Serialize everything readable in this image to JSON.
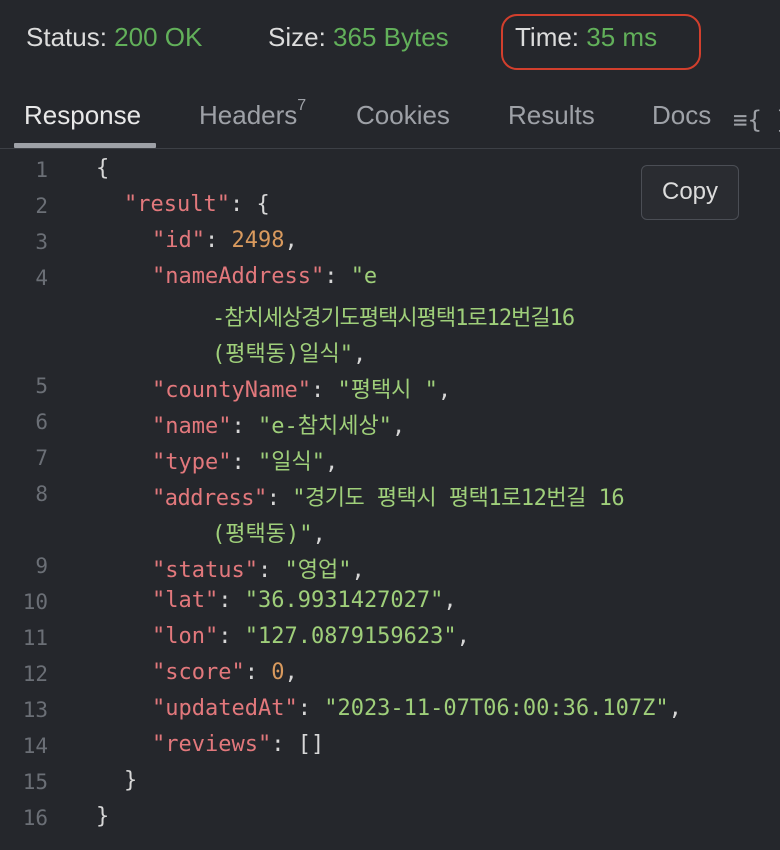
{
  "status_bar": {
    "status_label": "Status:",
    "status_value": "200 OK",
    "size_label": "Size:",
    "size_value": "365 Bytes",
    "time_label": "Time:",
    "time_value": "35 ms"
  },
  "tabs": [
    {
      "label": "Response",
      "active": true
    },
    {
      "label": "Headers",
      "badge": "7"
    },
    {
      "label": "Cookies"
    },
    {
      "label": "Results"
    },
    {
      "label": "Docs"
    }
  ],
  "menu_icon": "≡{ }",
  "copy_label": "Copy",
  "colors": {
    "status_ok": "#62b05a",
    "highlight_border": "#d23f2d",
    "json_key": "#e2787c",
    "json_string": "#9fcf7a",
    "json_number": "#d99a5e"
  },
  "code": {
    "line_numbers": [
      "1",
      "2",
      "3",
      "4",
      "5",
      "6",
      "7",
      "8",
      "9",
      "10",
      "11",
      "12",
      "13",
      "14",
      "15",
      "16"
    ],
    "result_key": "\"result\"",
    "id_key": "\"id\"",
    "id_val": "2498",
    "name_address_key": "\"nameAddress\"",
    "name_address_val_1": "\"e",
    "name_address_val_2": "-참치세상경기도평택시평택1로12번길16",
    "name_address_val_3": "(평택동)일식\"",
    "county_key": "\"countyName\"",
    "county_val": "\"평택시 \"",
    "name_key": "\"name\"",
    "name_val": "\"e-참치세상\"",
    "type_key": "\"type\"",
    "type_val": "\"일식\"",
    "address_key": "\"address\"",
    "address_val_1": "\"경기도 평택시 평택1로12번길 16",
    "address_val_2": "(평택동)\"",
    "status_key": "\"status\"",
    "status_val": "\"영업\"",
    "lat_key": "\"lat\"",
    "lat_val": "\"36.9931427027\"",
    "lon_key": "\"lon\"",
    "lon_val": "\"127.0879159623\"",
    "score_key": "\"score\"",
    "score_val": "0",
    "updated_key": "\"updatedAt\"",
    "updated_val": "\"2023-11-07T06:00:36.107Z\"",
    "reviews_key": "\"reviews\"",
    "reviews_val": "[]"
  }
}
